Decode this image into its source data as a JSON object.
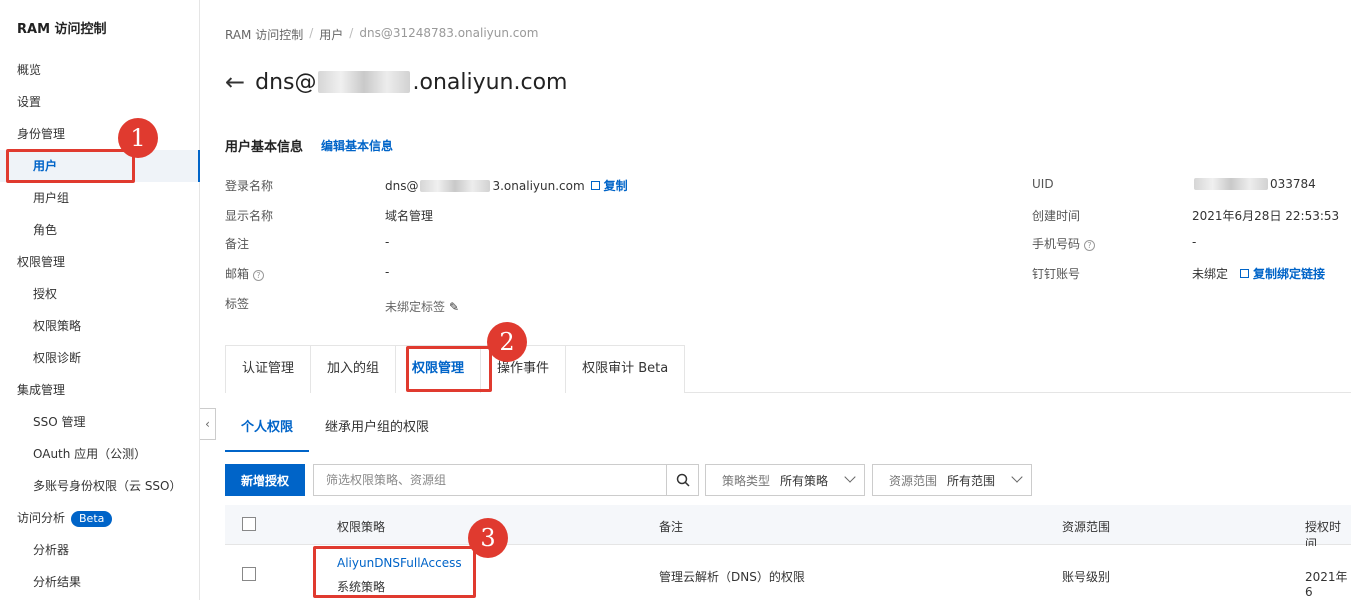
{
  "sidebar": {
    "title": "RAM 访问控制",
    "items": [
      {
        "label": "概览",
        "level": 1
      },
      {
        "label": "设置",
        "level": 1
      },
      {
        "label": "身份管理",
        "level": 1
      },
      {
        "label": "用户",
        "level": 2,
        "active": true
      },
      {
        "label": "用户组",
        "level": 2
      },
      {
        "label": "角色",
        "level": 2
      },
      {
        "label": "权限管理",
        "level": 1
      },
      {
        "label": "授权",
        "level": 2
      },
      {
        "label": "权限策略",
        "level": 2
      },
      {
        "label": "权限诊断",
        "level": 2
      },
      {
        "label": "集成管理",
        "level": 1
      },
      {
        "label": "SSO 管理",
        "level": 2
      },
      {
        "label": "OAuth 应用（公测）",
        "level": 2
      },
      {
        "label": "多账号身份权限（云 SSO）",
        "level": 2
      },
      {
        "label": "访问分析",
        "level": 1
      },
      {
        "label": "分析器",
        "level": 2
      },
      {
        "label": "分析结果",
        "level": 2
      }
    ],
    "beta_badge": "Beta"
  },
  "breadcrumb": [
    "RAM 访问控制",
    "用户",
    "dns@31248783.onaliyun.com"
  ],
  "page_title": {
    "prefix": "dns@",
    "suffix": ".onaliyun.com"
  },
  "basic_info": {
    "title": "用户基本信息",
    "edit_link": "编辑基本信息",
    "left": [
      {
        "label": "登录名称",
        "value_prefix": "dns@",
        "value_suffix": "3.onaliyun.com",
        "action": "复制"
      },
      {
        "label": "显示名称",
        "value": "域名管理"
      },
      {
        "label": "备注",
        "value": "-"
      },
      {
        "label": "邮箱",
        "value": "-"
      },
      {
        "label": "标签",
        "value": "未绑定标签"
      }
    ],
    "right": [
      {
        "label": "UID",
        "value": "033784"
      },
      {
        "label": "创建时间",
        "value": "2021年6月28日 22:53:53"
      },
      {
        "label": "手机号码",
        "value": "-"
      },
      {
        "label": "钉钉账号",
        "value": "未绑定",
        "action": "复制绑定链接"
      }
    ]
  },
  "tabs": [
    "认证管理",
    "加入的组",
    "权限管理",
    "操作事件",
    "权限审计 Beta"
  ],
  "active_tab": "权限管理",
  "subtabs": [
    "个人权限",
    "继承用户组的权限"
  ],
  "toolbar": {
    "add_button": "新增授权",
    "search_placeholder": "筛选权限策略、资源组",
    "filter_policy_type": {
      "label": "策略类型",
      "value": "所有策略"
    },
    "filter_scope": {
      "label": "资源范围",
      "value": "所有范围"
    }
  },
  "table": {
    "columns": [
      "权限策略",
      "备注",
      "资源范围",
      "授权时间"
    ],
    "rows": [
      {
        "policy": "AliyunDNSFullAccess",
        "policy_type": "系统策略",
        "note": "管理云解析（DNS）的权限",
        "scope": "账号级别",
        "time": "2021年6"
      }
    ]
  },
  "annotations": [
    "1",
    "2",
    "3"
  ],
  "colors": {
    "accent": "#0064c8",
    "annotation": "#e03a2f"
  }
}
